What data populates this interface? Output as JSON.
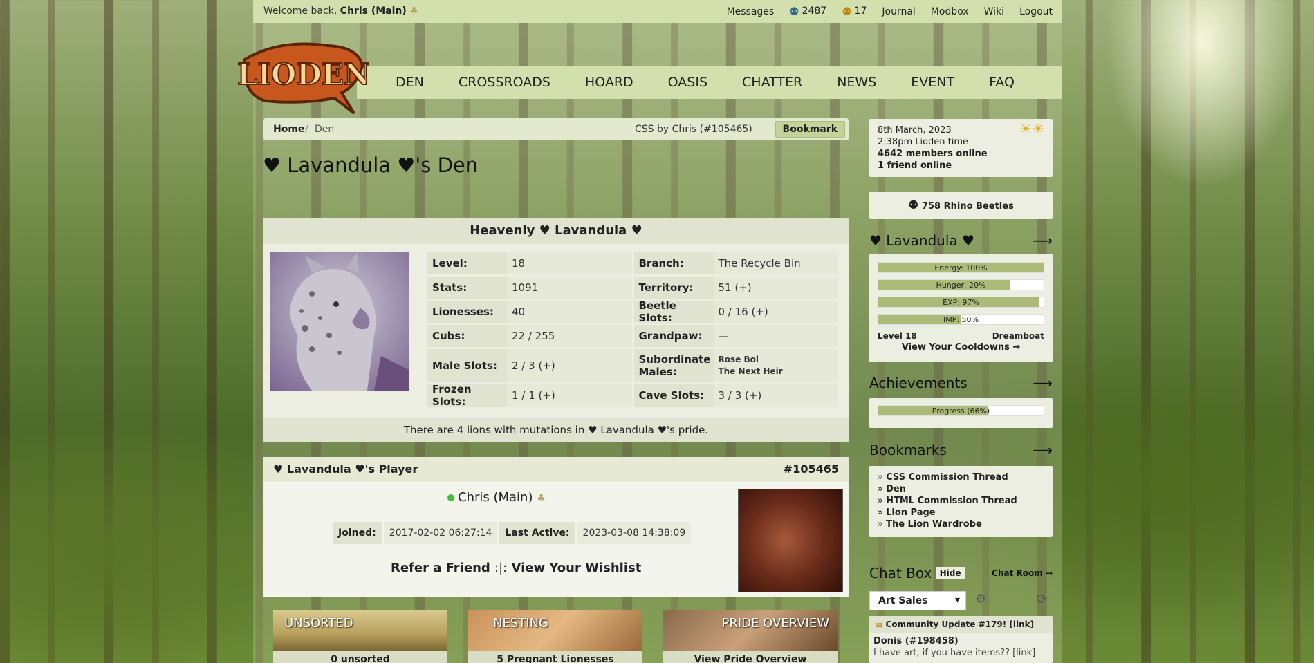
{
  "topbar": {
    "welcome_prefix": "Welcome back,",
    "user": "Chris (Main)",
    "items": [
      "Messages",
      "2487",
      "17",
      "Journal",
      "Modbox",
      "Wiki",
      "Logout"
    ]
  },
  "nav": [
    "DEN",
    "CROSSROADS",
    "HOARD",
    "OASIS",
    "CHATTER",
    "NEWS",
    "EVENT",
    "FAQ"
  ],
  "logo_text": "LIODEN",
  "breadcrumb": {
    "home": "Home",
    "sep": "/",
    "current": "Den",
    "credit": "CSS by Chris (#105465)",
    "bookmark": "Bookmark"
  },
  "page_title": "♥ Lavandula ♥'s Den",
  "lion": {
    "name": "Heavenly ♥ Lavandula ♥",
    "rows": [
      [
        {
          "l": "Level:",
          "v": "18"
        },
        {
          "l": "Branch:",
          "v": "The Recycle Bin"
        }
      ],
      [
        {
          "l": "Stats:",
          "v": "1091"
        },
        {
          "l": "Territory:",
          "v": "51 (+)"
        }
      ],
      [
        {
          "l": "Lionesses:",
          "v": "40"
        },
        {
          "l": "Beetle Slots:",
          "v": "0 / 16 (+)"
        }
      ],
      [
        {
          "l": "Cubs:",
          "v": "22 / 255"
        },
        {
          "l": "Grandpaw:",
          "v": "—"
        }
      ],
      [
        {
          "l": "Male Slots:",
          "v": "2 / 3 (+)"
        },
        {
          "l": "Subordinate Males:",
          "v": "Rose Boi\nThe Next Heir"
        }
      ],
      [
        {
          "l": "Frozen Slots:",
          "v": "1 / 1 (+)"
        },
        {
          "l": "Cave Slots:",
          "v": "3 / 3 (+)"
        }
      ]
    ],
    "mutations": "There are 4 lions with mutations in ♥ Lavandula ♥'s pride."
  },
  "player": {
    "header": "♥ Lavandula ♥'s Player",
    "id": "#105465",
    "name": "Chris (Main)",
    "joined_label": "Joined:",
    "joined": "2017-02-02 06:27:14",
    "active_label": "Last Active:",
    "active": "2023-03-08 14:38:09",
    "refer": "Refer a Friend",
    "wishlist": "View Your Wishlist"
  },
  "tiles": [
    {
      "label": "UNSORTED",
      "caption": "0 unsorted"
    },
    {
      "label": "NESTING",
      "caption": "5 Pregnant Lionesses"
    },
    {
      "label": "PRIDE OVERVIEW",
      "caption": "View Pride Overview"
    }
  ],
  "sidebar": {
    "time": {
      "date": "8th March, 2023",
      "time": "2:38pm Lioden time",
      "members": "4642 members online",
      "friends": "1 friend online"
    },
    "beetles": "758 Rhino Beetles",
    "lion_title": "♥ Lavandula ♥",
    "bars": [
      {
        "label": "Energy: 100%",
        "pct": 100
      },
      {
        "label": "Hunger: 20%",
        "pct": 80
      },
      {
        "label": "EXP: 97%",
        "pct": 97
      },
      {
        "label": "IMP: 50%",
        "pct": 50
      }
    ],
    "level": "Level 18",
    "title": "Dreamboat",
    "cooldowns": "View Your Cooldowns →",
    "achievements": "Achievements",
    "progress": {
      "label": "Progress (66%)",
      "pct": 66
    },
    "bookmarks_title": "Bookmarks",
    "bookmarks": [
      "CSS Commission Thread",
      "Den",
      "HTML Commission Thread",
      "Lion Page",
      "The Lion Wardrobe"
    ],
    "chat": {
      "title": "Chat Box",
      "hide": "Hide",
      "room": "Chat Room →",
      "select": "Art Sales",
      "update": "Community Update #179! [link]",
      "poster": "Donis (#198458)",
      "msg": "I have art, if you have items?? [link]"
    }
  }
}
